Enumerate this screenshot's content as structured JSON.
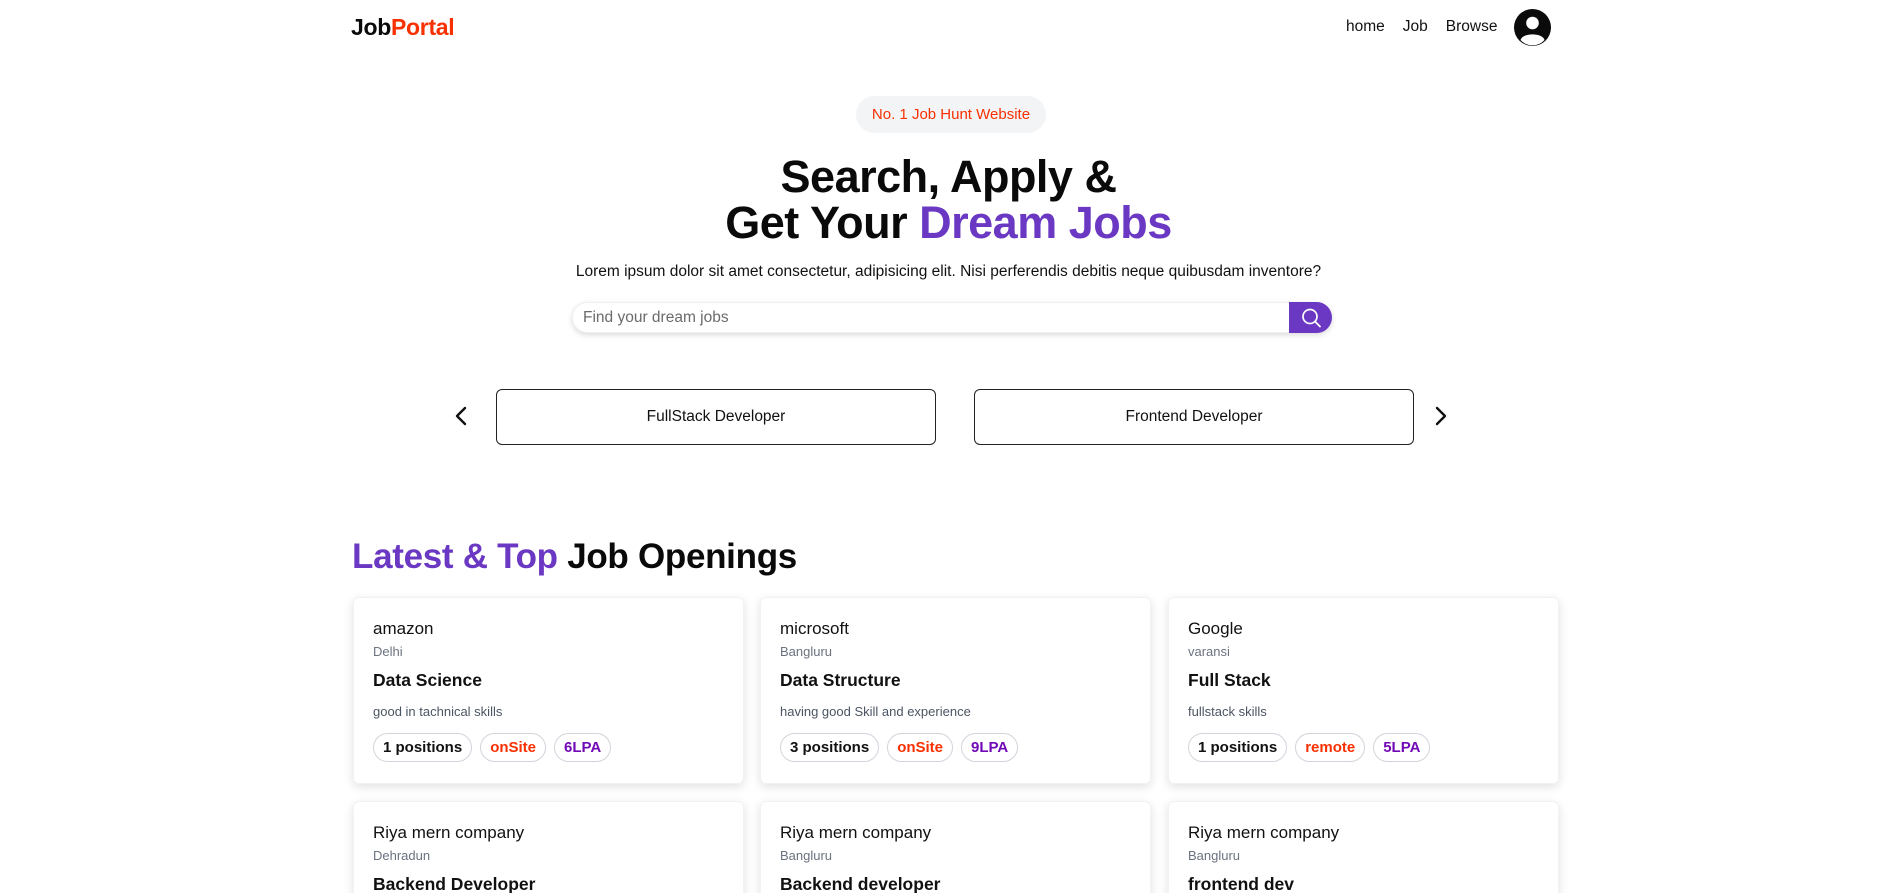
{
  "nav": {
    "logo_main": "Job",
    "logo_accent": "Portal",
    "links": [
      "home",
      "Job",
      "Browse"
    ]
  },
  "hero": {
    "badge": "No. 1 Job Hunt Website",
    "title_line1": "Search, Apply &",
    "title_line2_plain": "Get Your ",
    "title_line2_accent": "Dream Jobs",
    "description": "Lorem ipsum dolor sit amet consectetur, adipisicing elit. Nisi perferendis debitis neque quibusdam inventore?",
    "search_placeholder": "Find your dream jobs"
  },
  "carousel": {
    "categories": [
      "FullStack Developer",
      "Frontend Developer"
    ]
  },
  "latest": {
    "title_accent": "Latest & Top",
    "title_plain": " Job Openings",
    "jobs": [
      {
        "company": "amazon",
        "location": "Delhi",
        "title": "Data Science",
        "description": "good in tachnical skills",
        "positions": "1 positions",
        "job_type": "onSite",
        "salary": "6LPA"
      },
      {
        "company": "microsoft",
        "location": "Bangluru",
        "title": "Data Structure",
        "description": "having good Skill and experience",
        "positions": "3 positions",
        "job_type": "onSite",
        "salary": "9LPA"
      },
      {
        "company": "Google",
        "location": "varansi",
        "title": "Full Stack",
        "description": "fullstack skills",
        "positions": "1 positions",
        "job_type": "remote",
        "salary": "5LPA"
      },
      {
        "company": "Riya mern company",
        "location": "Dehradun",
        "title": "Backend Developer"
      },
      {
        "company": "Riya mern company",
        "location": "Bangluru",
        "title": "Backend developer"
      },
      {
        "company": "Riya mern company",
        "location": "Bangluru",
        "title": "frontend dev"
      }
    ]
  },
  "colors": {
    "accent_purple": "#6a38c2",
    "accent_red": "#f83002",
    "salary_purple": "#7209b7"
  },
  "icons": [
    "user-avatar-icon",
    "search-icon",
    "chevron-left-icon",
    "chevron-right-icon"
  ]
}
